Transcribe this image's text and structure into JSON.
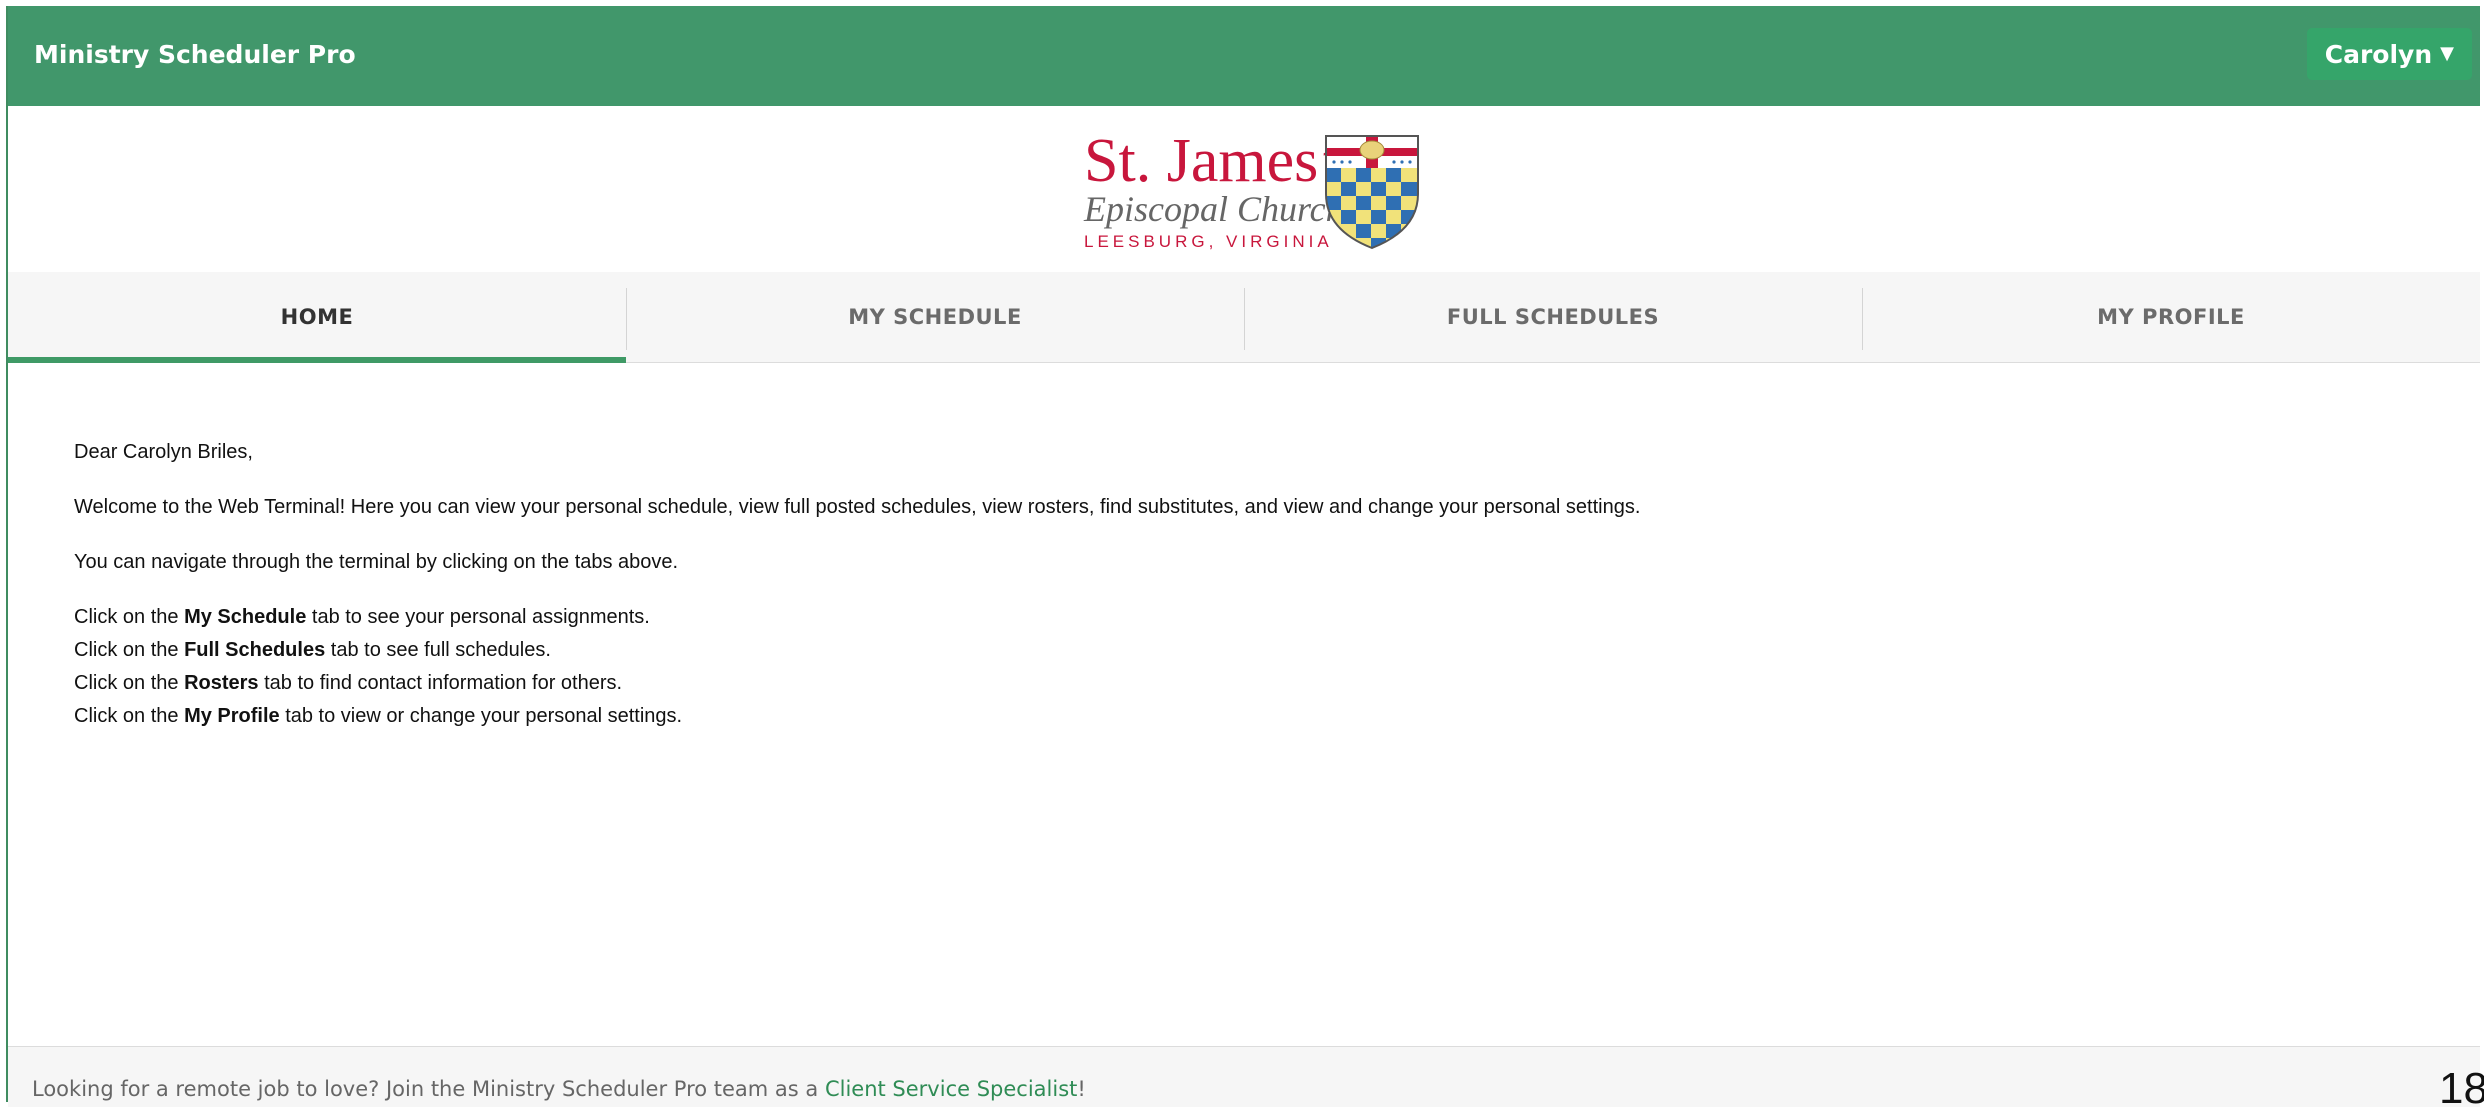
{
  "app": {
    "title": "Ministry Scheduler Pro",
    "user_menu": {
      "label": "Carolyn",
      "icon": "caret-down-icon"
    }
  },
  "logo": {
    "name_line": "St. James’",
    "sub_line": "Episcopal Church",
    "location_line": "LEESBURG, VIRGINIA",
    "colors": {
      "crimson": "#c8163c",
      "blue": "#2f6fb3",
      "gold": "#f1e27a"
    }
  },
  "tabs": [
    {
      "label": "HOME",
      "active": true
    },
    {
      "label": "MY SCHEDULE",
      "active": false
    },
    {
      "label": "FULL SCHEDULES",
      "active": false
    },
    {
      "label": "MY PROFILE",
      "active": false
    }
  ],
  "content": {
    "greeting": "Dear Carolyn Briles,",
    "welcome": "Welcome to the Web Terminal! Here you can view your personal schedule, view full posted schedules, view rosters, find substitutes, and view and change your personal settings.",
    "navigate": "You can navigate through the terminal by clicking on the tabs above.",
    "instructions": [
      {
        "prefix": "Click on the ",
        "bold": "My Schedule",
        "suffix": " tab to see your personal assignments."
      },
      {
        "prefix": "Click on the ",
        "bold": "Full Schedules",
        "suffix": " tab to see full schedules."
      },
      {
        "prefix": "Click on the ",
        "bold": "Rosters",
        "suffix": " tab to find contact information for others."
      },
      {
        "prefix": "Click on the ",
        "bold": "My Profile",
        "suffix": " tab to view or change your personal settings."
      }
    ]
  },
  "footer": {
    "text": "Looking for a remote job to love? Join the Ministry Scheduler Pro team as a ",
    "link": "Client Service Specialist",
    "end": "!"
  },
  "page_number": "18",
  "colors": {
    "topbar": "#41976b",
    "accent": "#3f9a66",
    "user_button": "#35a56a",
    "link": "#2f8c55"
  }
}
